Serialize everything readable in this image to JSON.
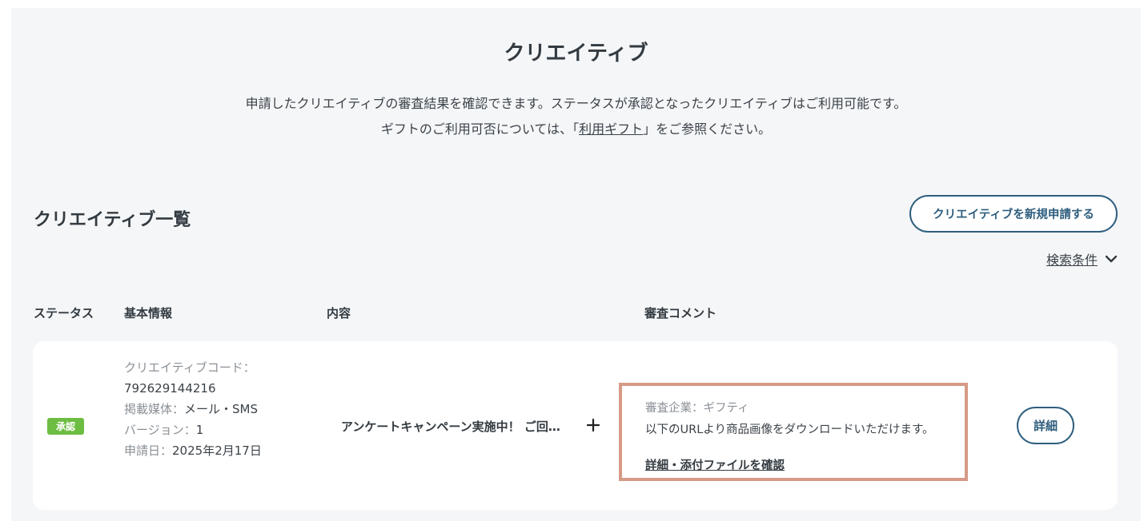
{
  "page": {
    "title": "クリエイティブ",
    "desc_line1": "申請したクリエイティブの審査結果を確認できます。ステータスが承認となったクリエイティブはご利用可能です。",
    "desc_line2_pre": "ギフトのご利用可否については、「",
    "desc_link": "利用ギフト",
    "desc_line2_post": "」をご参照ください。"
  },
  "list": {
    "title": "クリエイティブ一覧",
    "new_button": "クリエイティブを新規申請する",
    "search_label": "検索条件",
    "search_icon": "chevron-down-icon"
  },
  "columns": {
    "status": "ステータス",
    "basic": "基本情報",
    "content": "内容",
    "review": "審査コメント"
  },
  "row": {
    "status": "承認",
    "status_color": "#6ebd43",
    "code_label": "クリエイティブコード：",
    "code_value": "792629144216",
    "media_label": "掲載媒体：",
    "media_value": "メール・SMS",
    "version_label": "バージョン：",
    "version_value": "1",
    "date_label": "申請日：",
    "date_value": "2025年2月17日",
    "content_text": "アンケートキャンペーン実施中！ ご回答いただいた方に",
    "expand_icon": "plus-icon",
    "review_company_label": "審査企業：",
    "review_company_value": "ギフティ",
    "review_comment": "以下のURLより商品画像をダウンロードいただけます。",
    "review_detail_link": "詳細・添付ファイルを確認",
    "detail_button": "詳細"
  },
  "colors": {
    "accent": "#2f5e7e",
    "highlight_border": "#d69a86",
    "panel_bg": "#f4f6f8"
  }
}
